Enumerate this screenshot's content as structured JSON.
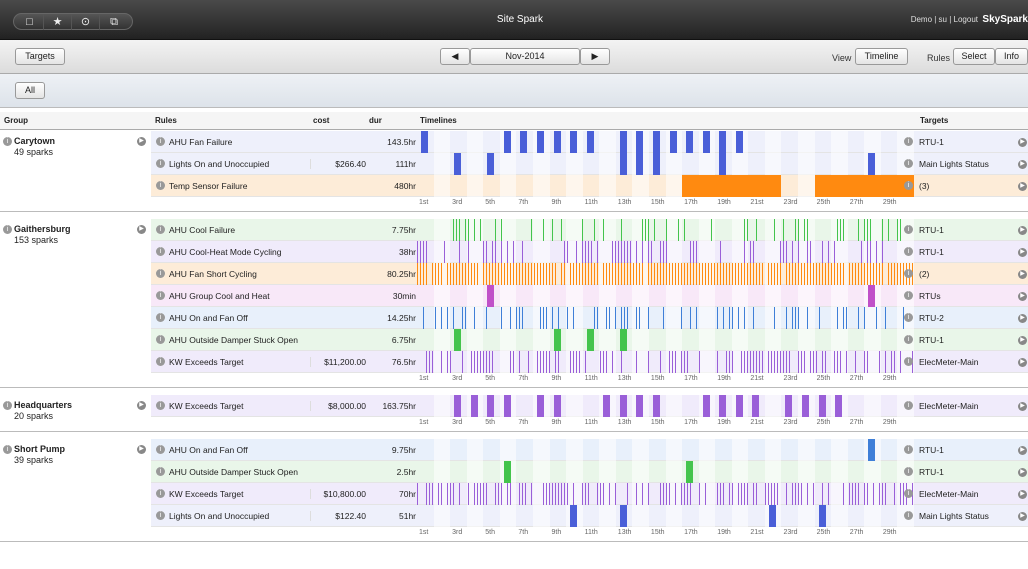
{
  "window": {
    "title": "Site Spark",
    "user": "Demo | su | Logout",
    "brand": "SkySpark",
    "title_buttons": [
      "□",
      "★",
      "⊙",
      "⧉"
    ]
  },
  "toolbar": {
    "targets_label": "Targets",
    "prev": "◀",
    "month": "Nov-2014",
    "next": "▶",
    "view_label": "View",
    "timeline_label": "Timeline",
    "rules_label": "Rules",
    "select_label": "Select",
    "info_label": "Info"
  },
  "filter": {
    "all_label": "All"
  },
  "columns": {
    "group": "Group",
    "rules": "Rules",
    "cost": "cost",
    "dur": "dur",
    "timelines": "Timelines",
    "targets": "Targets"
  },
  "axis_ticks": [
    "1st",
    "3rd",
    "5th",
    "7th",
    "9th",
    "11th",
    "13th",
    "15th",
    "17th",
    "19th",
    "21st",
    "23rd",
    "25th",
    "27th",
    "29th"
  ],
  "colors": {
    "blue": "#4a5fd8",
    "orange": "#ff8a10",
    "green": "#44c44c",
    "purple": "#9a5fd8",
    "magenta": "#c050c8",
    "steel": "#3f7fd8"
  },
  "groups": [
    {
      "name": "Carytown",
      "count": "49 sparks",
      "rows": [
        {
          "rule": "AHU Fan Failure",
          "cost": "",
          "dur": "143.5hr",
          "target": "RTU-1",
          "color": "blue",
          "bg": "#eef0fb",
          "days": [
            1,
            6,
            7,
            8,
            9,
            10,
            11,
            13,
            14,
            15,
            16,
            17,
            18,
            19,
            20
          ]
        },
        {
          "rule": "Lights On and Unoccupied",
          "cost": "$266.40",
          "dur": "111hr",
          "target": "Main Lights Status",
          "color": "blue",
          "bg": "#eef0fb",
          "days": [
            3,
            5,
            13,
            14,
            15,
            19,
            28
          ]
        },
        {
          "rule": "Temp Sensor Failure",
          "cost": "",
          "dur": "480hr",
          "target": "(3)",
          "color": "orange",
          "bg": "#fdecd8",
          "spans": [
            [
              17,
              23
            ],
            [
              25,
              31
            ]
          ]
        }
      ]
    },
    {
      "name": "Gaithersburg",
      "count": "153 sparks",
      "rows": [
        {
          "rule": "AHU Cool Failure",
          "cost": "",
          "dur": "7.75hr",
          "target": "RTU-1",
          "color": "green",
          "bg": "#e9f6e9",
          "dense": 0.35
        },
        {
          "rule": "AHU Cool-Heat Mode Cycling",
          "cost": "",
          "dur": "38hr",
          "target": "RTU-1",
          "color": "purple",
          "bg": "#f0ebfb",
          "dense": 0.3
        },
        {
          "rule": "AHU Fan Short Cycling",
          "cost": "",
          "dur": "80.25hr",
          "target": "(2)",
          "color": "orange",
          "bg": "#fdecd8",
          "dense": 0.9
        },
        {
          "rule": "AHU Group Cool and Heat",
          "cost": "",
          "dur": "30min",
          "target": "RTUs",
          "color": "magenta",
          "bg": "#f8e8f8",
          "days": [
            5,
            28
          ]
        },
        {
          "rule": "AHU On and Fan Off",
          "cost": "",
          "dur": "14.25hr",
          "target": "RTU-2",
          "color": "steel",
          "bg": "#e8f0fb",
          "dense": 0.4
        },
        {
          "rule": "AHU Outside Damper Stuck Open",
          "cost": "",
          "dur": "6.75hr",
          "target": "RTU-1",
          "color": "green",
          "bg": "#e9f6e9",
          "days": [
            3,
            9,
            11,
            13
          ]
        },
        {
          "rule": "KW Exceeds Target",
          "cost": "$11,200.00",
          "dur": "76.5hr",
          "target": "ElecMeter-Main",
          "color": "purple",
          "bg": "#f0ebfb",
          "dense": 0.55
        }
      ]
    },
    {
      "name": "Headquarters",
      "count": "20 sparks",
      "rows": [
        {
          "rule": "KW Exceeds Target",
          "cost": "$8,000.00",
          "dur": "163.75hr",
          "target": "ElecMeter-Main",
          "color": "purple",
          "bg": "#f0ebfb",
          "days": [
            3,
            4,
            5,
            6,
            8,
            9,
            12,
            13,
            14,
            15,
            18,
            19,
            20,
            21,
            23,
            24,
            25,
            26
          ]
        }
      ]
    },
    {
      "name": "Short Pump",
      "count": "39 sparks",
      "rows": [
        {
          "rule": "AHU On and Fan Off",
          "cost": "",
          "dur": "9.75hr",
          "target": "RTU-1",
          "color": "steel",
          "bg": "#e8f0fb",
          "days": [
            28
          ]
        },
        {
          "rule": "AHU Outside Damper Stuck Open",
          "cost": "",
          "dur": "2.5hr",
          "target": "RTU-1",
          "color": "green",
          "bg": "#e9f6e9",
          "days": [
            6,
            17
          ]
        },
        {
          "rule": "KW Exceeds Target",
          "cost": "$10,800.00",
          "dur": "70hr",
          "target": "ElecMeter-Main",
          "color": "purple",
          "bg": "#f0ebfb",
          "dense": 0.55
        },
        {
          "rule": "Lights On and Unoccupied",
          "cost": "$122.40",
          "dur": "51hr",
          "target": "Main Lights Status",
          "color": "blue",
          "bg": "#eef0fb",
          "days": [
            10,
            13,
            22,
            25
          ]
        }
      ]
    }
  ]
}
